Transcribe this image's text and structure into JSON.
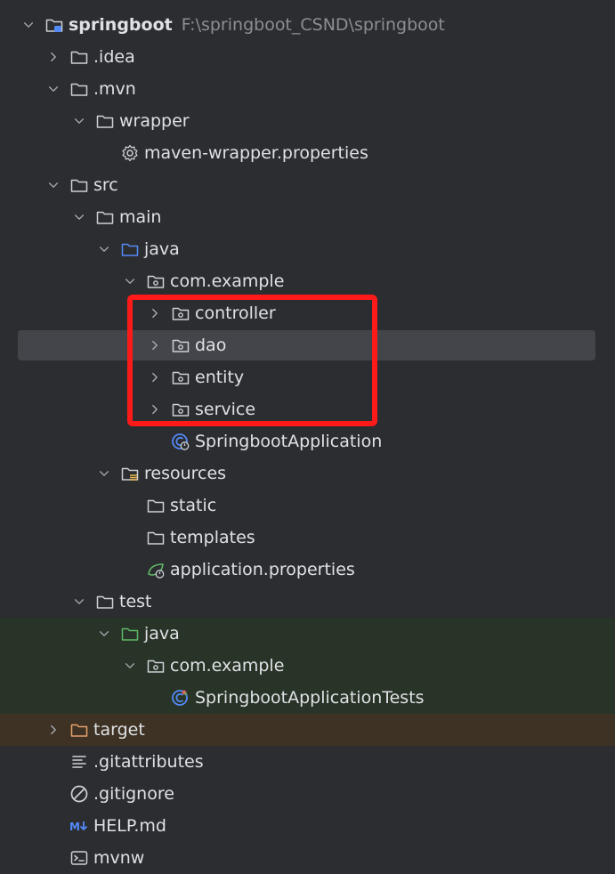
{
  "project": {
    "name": "springboot",
    "path": "F:\\springboot_CSND\\springboot"
  },
  "nodes": {
    "idea": ".idea",
    "mvn": ".mvn",
    "wrapper": "wrapper",
    "maven_wrapper_props": "maven-wrapper.properties",
    "src": "src",
    "main": "main",
    "main_java": "java",
    "main_pkg": "com.example",
    "controller": "controller",
    "dao": "dao",
    "entity": "entity",
    "service": "service",
    "app_class": "SpringbootApplication",
    "resources": "resources",
    "static": "static",
    "templates": "templates",
    "app_props": "application.properties",
    "test": "test",
    "test_java": "java",
    "test_pkg": "com.example",
    "test_class": "SpringbootApplicationTests",
    "target": "target",
    "gitattributes": ".gitattributes",
    "gitignore": ".gitignore",
    "help_md": "HELP.md",
    "mvnw": "mvnw"
  },
  "icons": {
    "folder": "folder-icon",
    "source_folder": "source-folder-icon",
    "test_folder": "test-folder-icon",
    "package": "package-icon",
    "resources_folder": "resources-folder-icon",
    "excluded_folder": "excluded-folder-icon",
    "settings": "gear-icon",
    "spring_class": "spring-boot-class-icon",
    "spring_props": "spring-properties-icon",
    "text_file": "text-lines-icon",
    "ignore_file": "ignore-icon",
    "markdown": "markdown-icon",
    "terminal": "terminal-icon"
  },
  "colors": {
    "background": "#2b2d30",
    "text": "#dfe1e5",
    "muted": "#8b8e94",
    "selection": "#43454a",
    "test_row": "#283428",
    "excluded_row": "#3d3223",
    "excluded_text": "#e8a06b",
    "source_blue": "#548af7",
    "test_green": "#5fb865",
    "highlight": "#ff1a1a"
  },
  "selected_node": "dao"
}
